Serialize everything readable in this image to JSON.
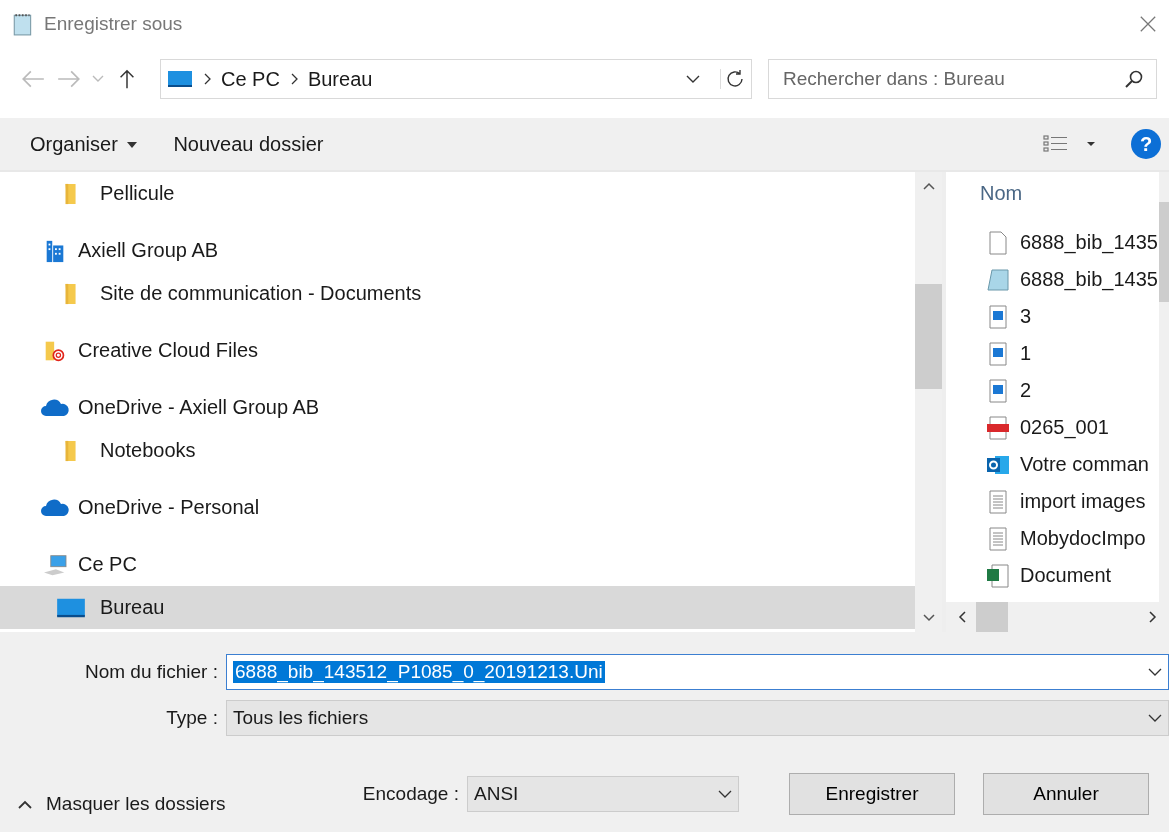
{
  "window": {
    "title": "Enregistrer sous"
  },
  "nav": {
    "path": [
      "Ce PC",
      "Bureau"
    ],
    "search_placeholder": "Rechercher dans : Bureau"
  },
  "toolbar": {
    "organize": "Organiser",
    "new_folder": "Nouveau dossier",
    "help": "?"
  },
  "tree": [
    {
      "children": [
        {
          "label": "Pellicule",
          "kind": "folder",
          "selected": false
        }
      ]
    },
    {
      "label": "Axiell Group AB",
      "kind": "building",
      "selected": false,
      "children": [
        {
          "label": "Site de communication - Documents",
          "kind": "folder",
          "selected": false
        }
      ]
    },
    {
      "label": "Creative Cloud Files",
      "kind": "cc",
      "selected": false
    },
    {
      "label": "OneDrive - Axiell Group AB",
      "kind": "cloud",
      "selected": false,
      "children": [
        {
          "label": "Notebooks",
          "kind": "folder",
          "selected": false
        }
      ]
    },
    {
      "label": "OneDrive - Personal",
      "kind": "cloud",
      "selected": false
    },
    {
      "label": "Ce PC",
      "kind": "pc",
      "selected": false,
      "children": [
        {
          "label": "Bureau",
          "kind": "desktop",
          "selected": true
        }
      ]
    }
  ],
  "files": {
    "column": "Nom",
    "items": [
      {
        "name": "6888_bib_1435",
        "kind": "blank"
      },
      {
        "name": "6888_bib_1435",
        "kind": "notepad"
      },
      {
        "name": "3",
        "kind": "image"
      },
      {
        "name": "1",
        "kind": "image"
      },
      {
        "name": "2",
        "kind": "image"
      },
      {
        "name": "0265_001",
        "kind": "pdf"
      },
      {
        "name": "Votre comman",
        "kind": "outlook"
      },
      {
        "name": "import images",
        "kind": "text"
      },
      {
        "name": "MobydocImpo",
        "kind": "text"
      },
      {
        "name": "Document",
        "kind": "excel"
      }
    ]
  },
  "form": {
    "filename_label": "Nom du fichier :",
    "filename": "6888_bib_143512_P1085_0_20191213.Uni",
    "type_label": "Type :",
    "type": "Tous les fichiers",
    "encoding_label": "Encodage :",
    "encoding": "ANSI"
  },
  "buttons": {
    "hide_folders": "Masquer les dossiers",
    "save": "Enregistrer",
    "cancel": "Annuler"
  }
}
